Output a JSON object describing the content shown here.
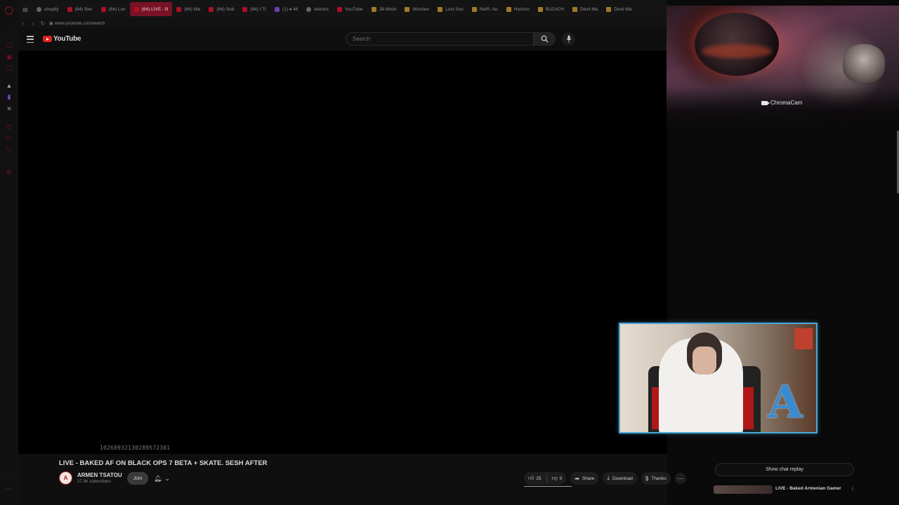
{
  "browser": {
    "tabs": [
      {
        "label": "shopify",
        "favicon": "document-icon",
        "active": false
      },
      {
        "label": "(64) Sen",
        "favicon": "youtube-icon",
        "active": false
      },
      {
        "label": "(64) Lon",
        "favicon": "youtube-icon",
        "active": false
      },
      {
        "label": "(64) LIVE - B",
        "favicon": "youtube-icon",
        "active": true
      },
      {
        "label": "(64) We",
        "favicon": "youtube-icon",
        "active": false
      },
      {
        "label": "(64) Sub",
        "favicon": "youtube-icon",
        "active": false
      },
      {
        "label": "(64) I Tr",
        "favicon": "youtube-icon",
        "active": false
      },
      {
        "label": "(1) ● Mi",
        "favicon": "twitch-icon",
        "active": false
      },
      {
        "label": "electric",
        "favicon": "globe-icon",
        "active": false
      },
      {
        "label": "YouTube",
        "favicon": "youtube-icon",
        "active": false
      },
      {
        "label": "Jill Mock",
        "favicon": "folder-icon",
        "active": false
      },
      {
        "label": "Wochen",
        "favicon": "folder-icon",
        "active": false
      },
      {
        "label": "Lost Sou",
        "favicon": "folder-icon",
        "active": false
      },
      {
        "label": "NieR: Au",
        "favicon": "folder-icon",
        "active": false
      },
      {
        "label": "Horizon",
        "favicon": "folder-icon",
        "active": false
      },
      {
        "label": "BLEACH",
        "favicon": "folder-icon",
        "active": false
      },
      {
        "label": "Devil Ma",
        "favicon": "folder-icon",
        "active": false
      },
      {
        "label": "Devil Ma",
        "favicon": "folder-icon",
        "active": false
      }
    ],
    "url": "www.youtube.com/watch"
  },
  "youtube": {
    "logo_text": "YouTube",
    "search_placeholder": "Search"
  },
  "video": {
    "overlay_number": "1026893213028957​2301",
    "title": "LIVE - BAKED AF ON BLACK OPS 7 BETA + SKATE. SESH AFTER",
    "channel_name": "ARMEN TSATOU",
    "subscribers": "27.3K subscribers",
    "avatar_initials": "A",
    "join_label": "Join",
    "likes": "25",
    "dislikes": "0",
    "share_label": "Share",
    "download_label": "Download",
    "thanks_label": "Thanks"
  },
  "overlay": {
    "chromacam_label": "ChromaCam",
    "webcam_logo": "A"
  },
  "sidebar_right": {
    "show_chat_label": "Show chat replay",
    "next_video_title": "LIVE - Baked Armenian Gamer"
  },
  "colors": {
    "accent": "#7a1226",
    "youtube_red": "#e01f1f",
    "webcam_border": "#4aa8d8"
  }
}
